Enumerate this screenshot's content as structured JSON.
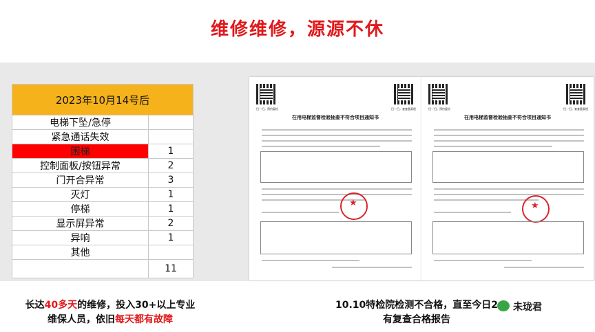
{
  "title": "维修维修，源源不休",
  "table": {
    "header": "2023年10月14号后",
    "rows": [
      {
        "name": "电梯下坠/急停",
        "count": ""
      },
      {
        "name": "紧急通话失效",
        "count": ""
      },
      {
        "name": "困梯",
        "count": "1"
      },
      {
        "name": "控制面板/按钮异常",
        "count": "2"
      },
      {
        "name": "门开合异常",
        "count": "3"
      },
      {
        "name": "灭灯",
        "count": "1"
      },
      {
        "name": "停梯",
        "count": "1"
      },
      {
        "name": "显示屏异常",
        "count": "2"
      },
      {
        "name": "异响",
        "count": "1"
      },
      {
        "name": "其他",
        "count": ""
      }
    ],
    "total": "11",
    "highlight_color": "#ff0000",
    "header_color": "#f5b21a"
  },
  "doc1": {
    "title": "在用电梯监督检验抽查不符合项目通知书",
    "qr_left": "扫一扫，预约复检",
    "qr_right": "扫一扫，查查备案程"
  },
  "doc2": {
    "title": "在用电梯监督检验抽查不符合项目通知书",
    "qr_left": "扫一扫，预约复检",
    "qr_right": "扫一扫，查查备案程"
  },
  "caption_left": {
    "pre": "长达",
    "hl1": "40多天",
    "mid": "的维修，投入30+以上专业",
    "line2_pre": "维保人员，依旧",
    "hl2": "每天都有故障"
  },
  "caption_right": {
    "line1": "10.10特检院检测不合格，直至今日2",
    "line2": "有复查合格报告"
  },
  "watermark": "未珑君",
  "accent": "#e0191c"
}
